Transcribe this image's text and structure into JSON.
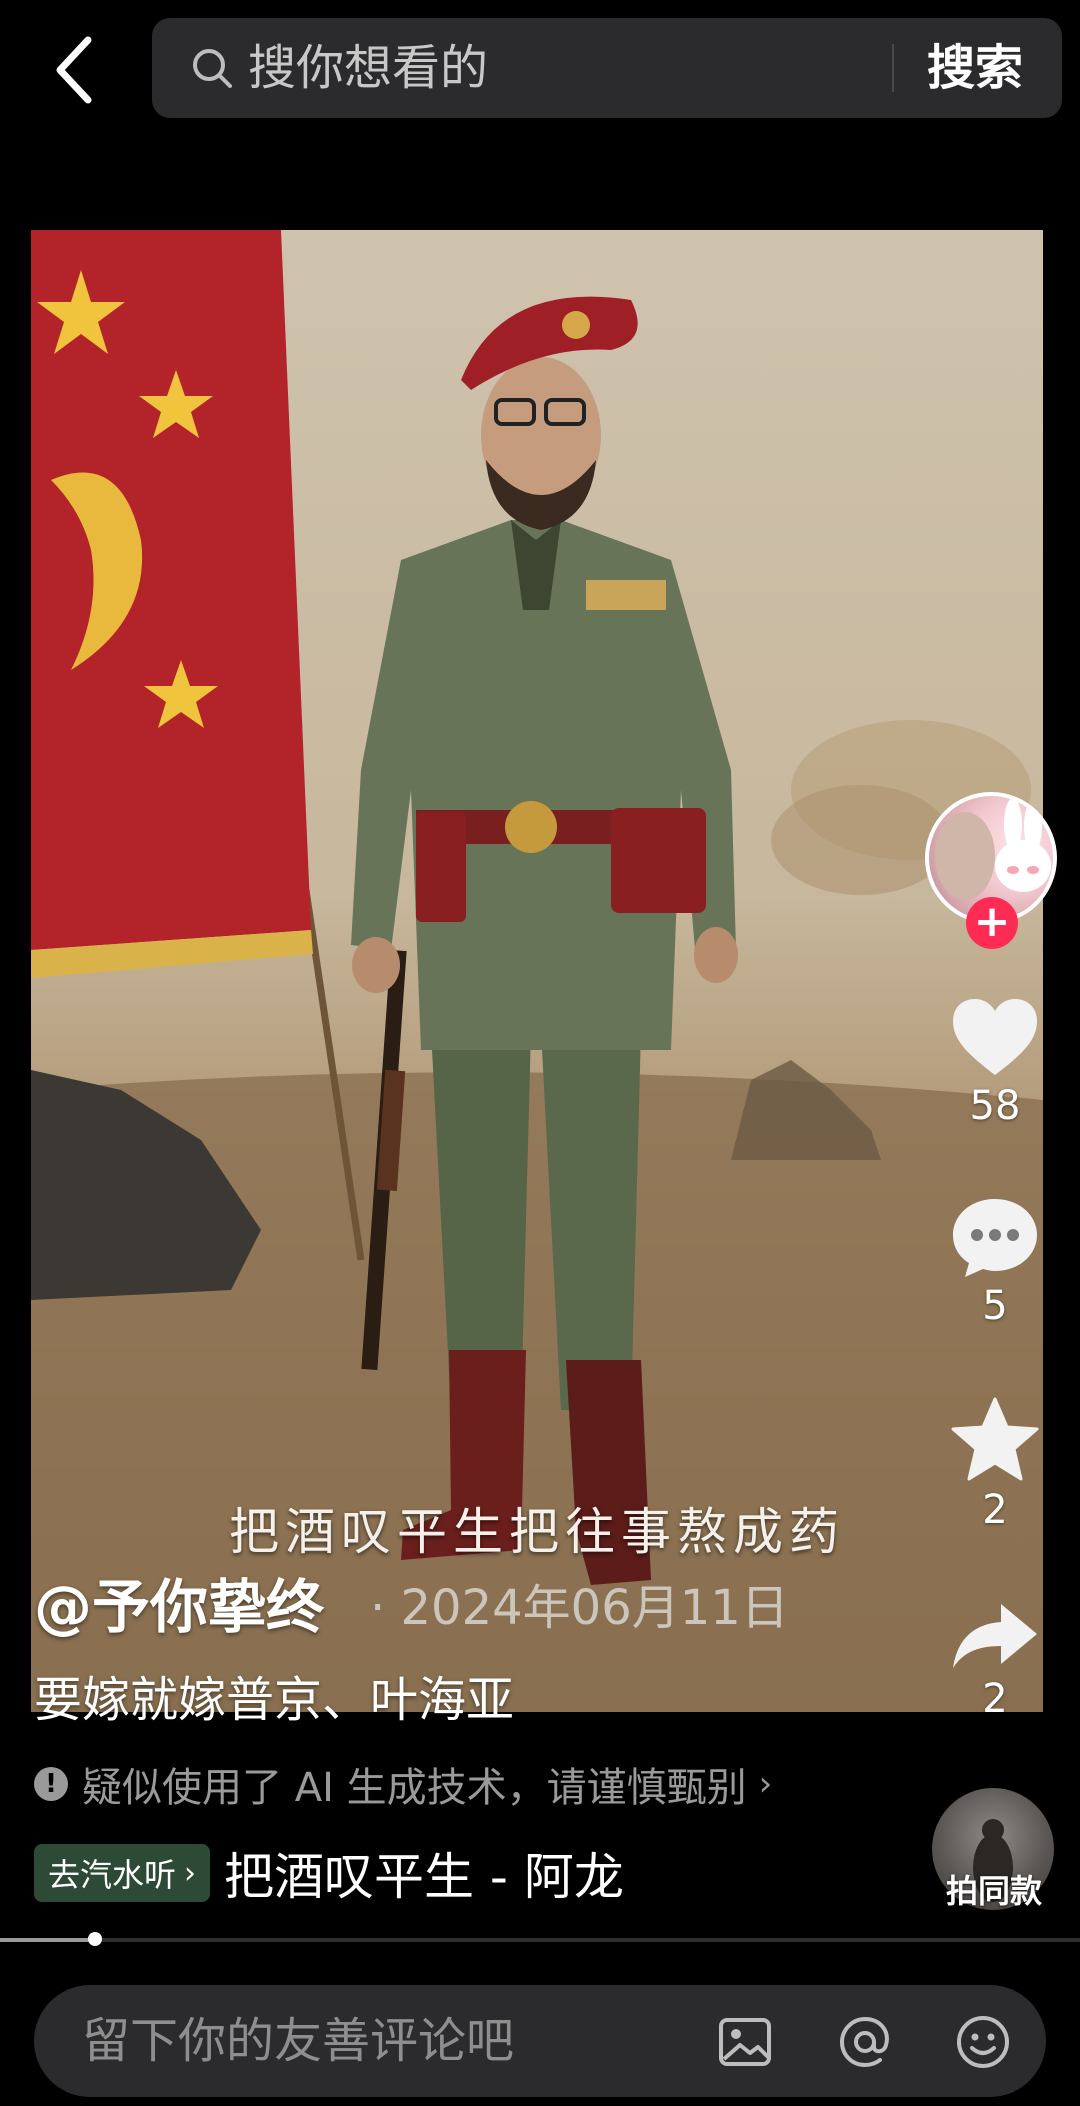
{
  "search": {
    "placeholder": "搜你想看的",
    "button": "搜索"
  },
  "video": {
    "overlay_caption": "把酒叹平生把往事熬成药"
  },
  "actions": {
    "likes": "58",
    "comments": "5",
    "favorites": "2",
    "shares": "2",
    "follow": "+"
  },
  "post": {
    "author": "@予你挚终",
    "date": "· 2024年06月11日",
    "description": "要嫁就嫁普京、叶海亚"
  },
  "ai_notice": {
    "text": "疑似使用了 AI 生成技术，请谨慎甄别",
    "chevron": "›"
  },
  "music": {
    "tag": "去汽水听",
    "tag_chevron": "›",
    "title": "把酒叹平生 - 阿龙",
    "same_style": "拍同款"
  },
  "playback": {
    "progress": 0.088
  },
  "comment": {
    "placeholder": "留下你的友善评论吧"
  },
  "colors": {
    "accent": "#fe2c55",
    "background": "#000000",
    "input_bg": "#2b2b2d"
  }
}
